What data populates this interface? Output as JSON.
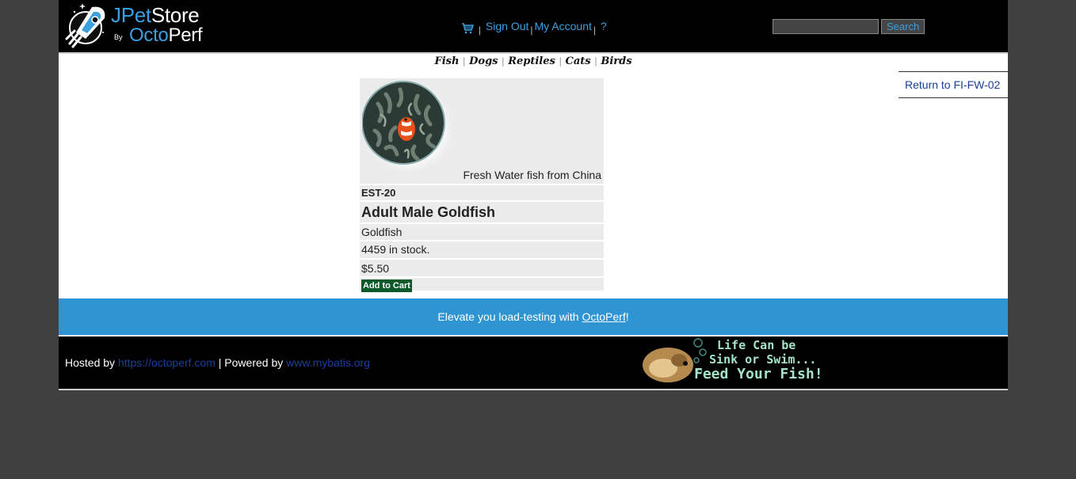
{
  "header": {
    "logo": {
      "part1": "JPet",
      "part2": "Store",
      "by": "By",
      "brand1": "Octo",
      "brand2": "Perf"
    },
    "menu": {
      "sign_out": "Sign Out",
      "my_account": "My Account",
      "help": "?"
    },
    "search": {
      "button": "Search",
      "value": ""
    }
  },
  "quicklinks": [
    "Fish",
    "Dogs",
    "Reptiles",
    "Cats",
    "Birds"
  ],
  "back_link": "Return to FI-FW-02",
  "item": {
    "image_description": "Fresh Water fish from China",
    "id": "EST-20",
    "name": "Adult Male Goldfish",
    "product": "Goldfish",
    "stock": "4459 in stock.",
    "price": "$5.50",
    "add_to_cart": "Add to Cart"
  },
  "banner": {
    "prefix": "Elevate you load-testing with ",
    "link": "OctoPerf",
    "suffix": "!"
  },
  "footer": {
    "hosted_by": "Hosted by ",
    "hosted_link": "https://octoperf.com",
    "powered_by": " | Powered by ",
    "powered_link": "www.mybatis.org",
    "ad_line1": "Life Can be",
    "ad_line2": "Sink or Swim...",
    "ad_line3": "Feed Your Fish!"
  },
  "colors": {
    "background": "#404040",
    "header": "#000000",
    "accent": "#3aa0e0",
    "banner": "#2e94d2",
    "cart_button": "#0c5a2a",
    "link": "#1a3f9a"
  }
}
